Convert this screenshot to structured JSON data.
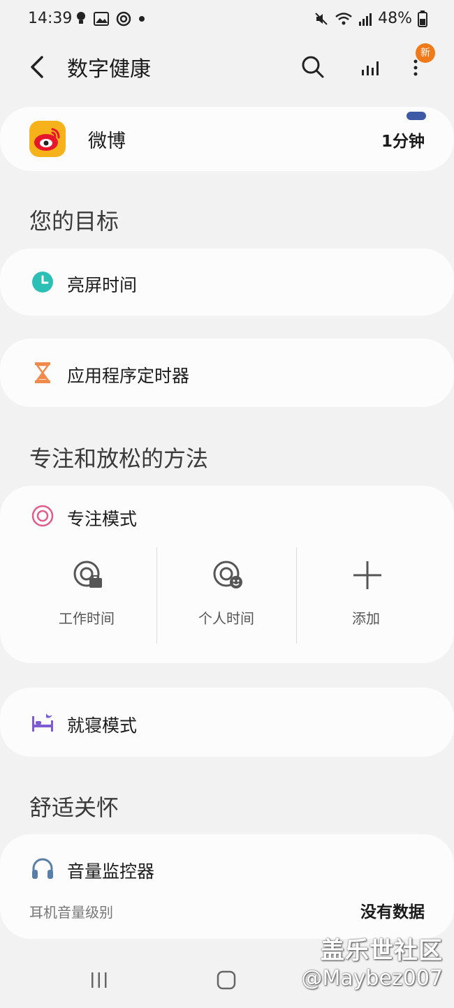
{
  "status_bar": {
    "time": "14:39",
    "battery": "48%"
  },
  "header": {
    "back_icon": "back-arrow-icon",
    "title": "数字健康",
    "search_icon": "search-icon",
    "stats_icon": "bar-chart-icon",
    "more_icon": "more-vertical-icon",
    "badge": "新"
  },
  "app_usage": {
    "app_name": "微博",
    "time": "1分钟",
    "bar_color": "#3e5aa6"
  },
  "goals": {
    "section_title": "您的目标",
    "screen_time": "亮屏时间",
    "app_timer": "应用程序定时器"
  },
  "focus": {
    "section_title": "专注和放松的方法",
    "focus_mode": "专注模式",
    "options": [
      {
        "label": "工作时间",
        "icon": "work-focus-icon"
      },
      {
        "label": "个人时间",
        "icon": "personal-focus-icon"
      },
      {
        "label": "添加",
        "icon": "plus-icon"
      }
    ],
    "bedtime_mode": "就寝模式"
  },
  "wellbeing": {
    "section_title": "舒适关怀",
    "volume_monitor": "音量监控器",
    "sub_label": "耳机音量级别",
    "value": "没有数据"
  },
  "watermark": {
    "line1": "盖乐世社区",
    "line2": "@Maybez007"
  },
  "colors": {
    "accent_teal": "#2bbfb6",
    "hourglass": "#f08a4b",
    "focus_pink": "#e05d8a",
    "bedtime_purple": "#7d5bd0",
    "headphone_blue": "#5a7fa6",
    "badge_orange": "#f07a1a"
  }
}
